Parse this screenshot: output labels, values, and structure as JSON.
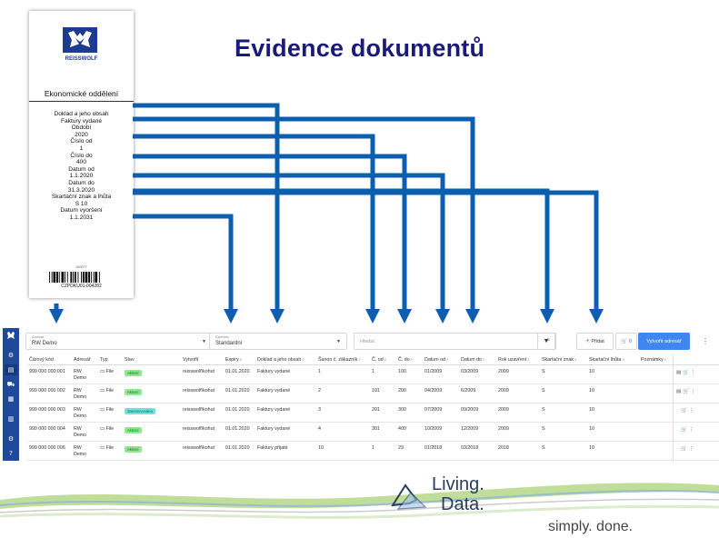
{
  "slide": {
    "title": "Evidence dokumentů"
  },
  "label": {
    "brand": "REISSWOLF",
    "department": "Ekonomické oddělení",
    "fields": [
      {
        "label": "Doklad a jeho obsah",
        "value": "Faktury vydané"
      },
      {
        "label": "Období",
        "value": "2020"
      },
      {
        "label": "Číslo od",
        "value": "1"
      },
      {
        "label": "Číslo do",
        "value": "400"
      },
      {
        "label": "Datum od",
        "value": "1.1.2020"
      },
      {
        "label": "Datum do",
        "value": "31.3.2020"
      },
      {
        "label": "Skartační znak a lhůta",
        "value": "S 10"
      },
      {
        "label": "Datum vyoršení",
        "value": "1.1.2031"
      }
    ],
    "small_code": "10097T",
    "barcode_text": "CZPDKU01-004282"
  },
  "toolbar": {
    "address_caption": "Adresář",
    "address_value": "RW Demo",
    "expiry_caption": "Expirace",
    "expiry_value": "Standardní",
    "search_placeholder": "Hledat",
    "add_label": "Přidat",
    "cart_count": "0",
    "create_label": "Vytvořit adresář"
  },
  "table": {
    "headers": [
      "Čárový kód",
      "Adresář",
      "Typ",
      "Stav",
      "Vytvořil",
      "Expiry",
      "Doklad a jeho obsah",
      "Šanon č. zákazník",
      "Č. od",
      "Č. do",
      "Datum od",
      "Datum do",
      "Rok uzavření",
      "Skartační znak",
      "Skartační lhůta",
      "Poznámky"
    ],
    "rows": [
      {
        "barcode": "999 000 000 001",
        "address": "RW Demo",
        "type": "File",
        "status": "Aktivní",
        "status_color": "green",
        "creator": "reisswolf\\kohut",
        "expiry": "01.01.2020",
        "content": "Faktury vydané",
        "binder": "1",
        "from": "1",
        "to": "100",
        "date_from": "01/2009",
        "date_to": "03/2009",
        "year": "2009",
        "mark": "S",
        "period": "10"
      },
      {
        "barcode": "999 000 000 002",
        "address": "RW Demo",
        "type": "File",
        "status": "Aktivní",
        "status_color": "green",
        "creator": "reisswolf\\kohut",
        "expiry": "01.01.2020",
        "content": "Faktury vydané",
        "binder": "2",
        "from": "101",
        "to": "200",
        "date_from": "04/2009",
        "date_to": "6/2009",
        "year": "2009",
        "mark": "S",
        "period": "10"
      },
      {
        "barcode": "999 000 000 003",
        "address": "RW Demo",
        "type": "File",
        "status": "Zarezervováno",
        "status_color": "cyan",
        "creator": "reisswolf\\kohut",
        "expiry": "01.01.2020",
        "content": "Faktury vydané",
        "binder": "3",
        "from": "201",
        "to": "300",
        "date_from": "07/2009",
        "date_to": "09/2009",
        "year": "2009",
        "mark": "S",
        "period": "10"
      },
      {
        "barcode": "999 000 000 004",
        "address": "RW Demo",
        "type": "File",
        "status": "Aktivní",
        "status_color": "green",
        "creator": "reisswolf\\kohut",
        "expiry": "01.01.2020",
        "content": "Faktury vydané",
        "binder": "4",
        "from": "301",
        "to": "400",
        "date_from": "10/2009",
        "date_to": "12/2009",
        "year": "2009",
        "mark": "S",
        "period": "10"
      },
      {
        "barcode": "999 000 000 006",
        "address": "RW Demo",
        "type": "File",
        "status": "Aktivní",
        "status_color": "green",
        "creator": "reisswolf\\kohut",
        "expiry": "01.01.2020",
        "content": "Faktury přijaté",
        "binder": "10",
        "from": "1",
        "to": "29",
        "date_from": "01/2018",
        "date_to": "03/2018",
        "year": "2018",
        "mark": "S",
        "period": "10"
      }
    ]
  },
  "branding": {
    "line1": "Living.",
    "line2": "Data.",
    "tagline": "simply. done."
  },
  "colors": {
    "arrow": "#0b5fae",
    "sidebar": "#1f4a9a",
    "primary_button": "#3f86f0",
    "title": "#1a1a7a"
  }
}
